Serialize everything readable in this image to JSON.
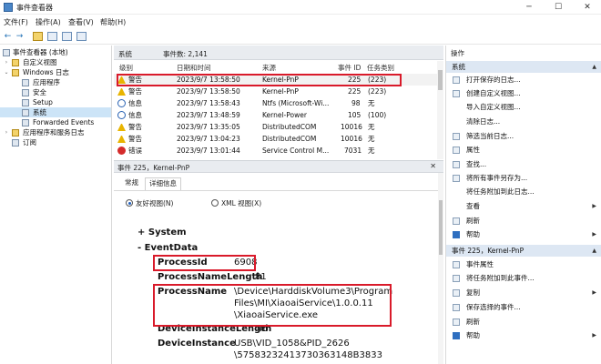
{
  "window": {
    "title": "事件查看器",
    "minimize": "─",
    "maximize": "☐",
    "close": "✕"
  },
  "menu": [
    "文件(F)",
    "操作(A)",
    "查看(V)",
    "帮助(H)"
  ],
  "toolbar": {
    "back": "←",
    "forward": "→"
  },
  "tree": [
    {
      "label": "事件查看器 (本地)",
      "expander": "",
      "indent": 0
    },
    {
      "label": "自定义视图",
      "expander": "›",
      "indent": 1
    },
    {
      "label": "Windows 日志",
      "expander": "⌄",
      "indent": 1
    },
    {
      "label": "应用程序",
      "expander": "",
      "indent": 2
    },
    {
      "label": "安全",
      "expander": "",
      "indent": 2
    },
    {
      "label": "Setup",
      "expander": "",
      "indent": 2
    },
    {
      "label": "系统",
      "expander": "",
      "indent": 2,
      "selected": true
    },
    {
      "label": "Forwarded Events",
      "expander": "",
      "indent": 2
    },
    {
      "label": "应用程序和服务日志",
      "expander": "›",
      "indent": 1
    },
    {
      "label": "订阅",
      "expander": "",
      "indent": 1
    }
  ],
  "log_panel": {
    "name": "系统",
    "count_label": "事件数: 2,141"
  },
  "columns": [
    "级别",
    "日期和时间",
    "来源",
    "事件 ID",
    "任务类别"
  ],
  "events": [
    {
      "level": "警告",
      "icon": "warning",
      "datetime": "2023/9/7 13:58:50",
      "source": "Kernel-PnP",
      "id": "225",
      "category": "(223)",
      "selected": true
    },
    {
      "level": "警告",
      "icon": "warning",
      "datetime": "2023/9/7 13:58:50",
      "source": "Kernel-PnP",
      "id": "225",
      "category": "(223)"
    },
    {
      "level": "信息",
      "icon": "info",
      "datetime": "2023/9/7 13:58:43",
      "source": "Ntfs (Microsoft-Wi...",
      "id": "98",
      "category": "无"
    },
    {
      "level": "信息",
      "icon": "info",
      "datetime": "2023/9/7 13:48:59",
      "source": "Kernel-Power",
      "id": "105",
      "category": "(100)"
    },
    {
      "level": "警告",
      "icon": "warning",
      "datetime": "2023/9/7 13:35:05",
      "source": "DistributedCOM",
      "id": "10016",
      "category": "无"
    },
    {
      "level": "警告",
      "icon": "warning",
      "datetime": "2023/9/7 13:04:23",
      "source": "DistributedCOM",
      "id": "10016",
      "category": "无"
    },
    {
      "level": "错误",
      "icon": "error",
      "datetime": "2023/9/7 13:01:44",
      "source": "Service Control M...",
      "id": "7031",
      "category": "无"
    }
  ],
  "detail": {
    "header": "事件 225，Kernel-PnP",
    "close": "✕",
    "tabs": [
      "常规",
      "详细信息"
    ],
    "radio_friendly": "友好视图(N)",
    "radio_xml": "XML 视图(X)",
    "system_node": "+ System",
    "eventdata_node": "- EventData",
    "fields": [
      {
        "name": "ProcessId",
        "value": "6908"
      },
      {
        "name": "ProcessNameLength",
        "value": "81"
      },
      {
        "name": "ProcessName",
        "value_lines": [
          "\\Device\\HarddiskVolume3\\Program",
          "Files\\MI\\XiaoaiService\\1.0.0.11",
          "\\XiaoaiService.exe"
        ]
      },
      {
        "name": "DeviceInstanceLength",
        "value": "46"
      },
      {
        "name": "DeviceInstance",
        "value_lines": [
          "USB\\VID_1058&PID_2626",
          "\\57583232413730363148B3833"
        ]
      }
    ]
  },
  "actions": {
    "title": "操作",
    "section1": "系统",
    "items1": [
      {
        "label": "打开保存的日志...",
        "more": ""
      },
      {
        "label": "创建自定义视图...",
        "more": ""
      },
      {
        "label": "导入自定义视图...",
        "more": ""
      },
      {
        "label": "清除日志...",
        "more": ""
      },
      {
        "label": "筛选当前日志...",
        "more": ""
      },
      {
        "label": "属性",
        "more": ""
      },
      {
        "label": "查找...",
        "more": ""
      },
      {
        "label": "将所有事件另存为...",
        "more": ""
      },
      {
        "label": "将任务附加到此日志...",
        "more": ""
      },
      {
        "label": "查看",
        "more": "▶"
      },
      {
        "label": "刷新",
        "more": ""
      },
      {
        "label": "帮助",
        "more": "▶"
      }
    ],
    "section2": "事件 225，Kernel-PnP",
    "items2": [
      {
        "label": "事件属性",
        "more": ""
      },
      {
        "label": "将任务附加到此事件...",
        "more": ""
      },
      {
        "label": "复制",
        "more": "▶"
      },
      {
        "label": "保存选择的事件...",
        "more": ""
      },
      {
        "label": "刷新",
        "more": ""
      },
      {
        "label": "帮助",
        "more": "▶"
      }
    ],
    "collapse": "▲"
  },
  "accent": "#d91a2a"
}
